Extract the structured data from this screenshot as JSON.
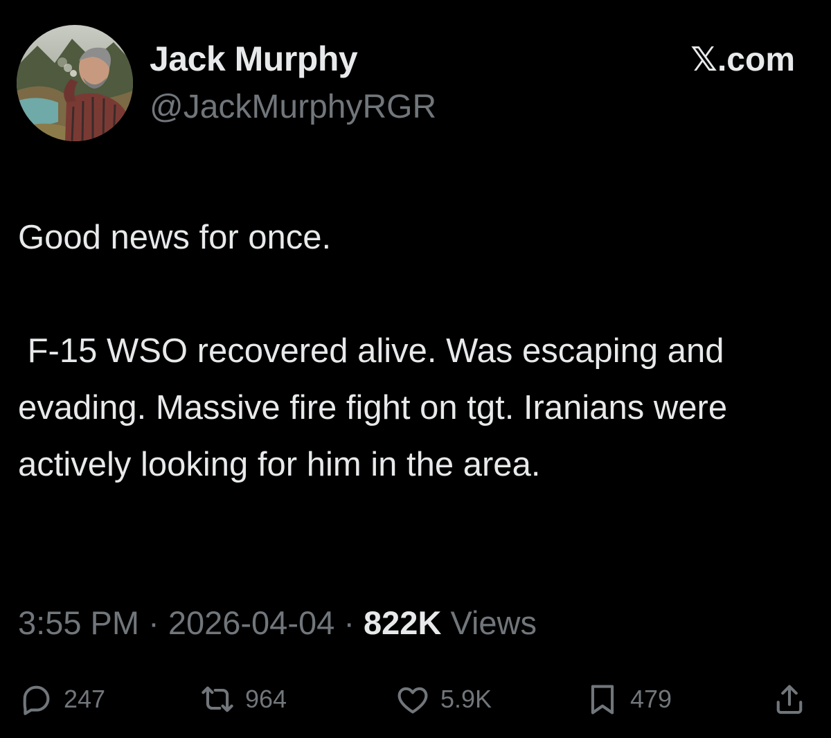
{
  "author": {
    "display_name": "Jack Murphy",
    "handle": "@JackMurphyRGR"
  },
  "brand": "𝕏.com",
  "post": {
    "paragraphs": [
      "Good news for once.",
      " F-15 WSO recovered alive. Was escaping and evading. Massive fire fight on tgt. Iranians were actively looking for him in the area."
    ]
  },
  "meta": {
    "time": "3:55 PM",
    "separator": "·",
    "date": "2026-04-04",
    "views_count": "822K",
    "views_label": "Views"
  },
  "actions": {
    "replies": "247",
    "reposts": "964",
    "likes": "5.9K",
    "bookmarks": "479"
  },
  "colors": {
    "background": "#000000",
    "primary_text": "#e7e9ea",
    "secondary_text": "#71767b"
  }
}
